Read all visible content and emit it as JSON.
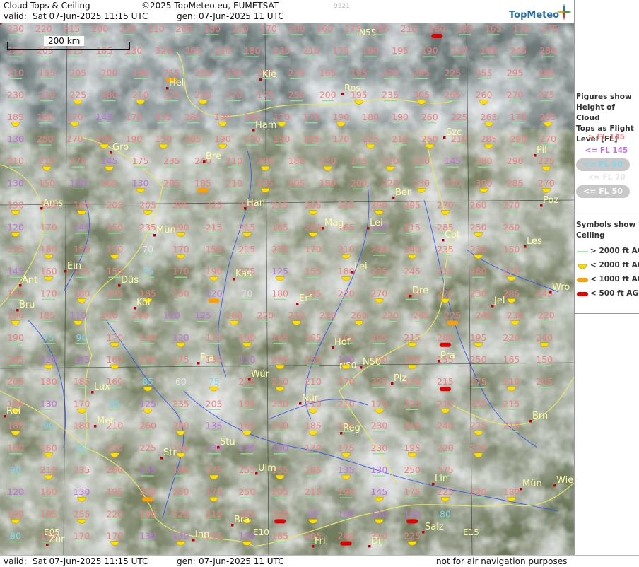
{
  "header": {
    "title": "Cloud Tops & Ceiling",
    "copyright": "©2025 TopMeteo.eu, EUMETSAT",
    "image_code": "9521",
    "valid_label": "valid:",
    "valid_value": "Sat   07-Jun-2025  11:15 UTC",
    "gen_label": "gen:",
    "gen_value": "07-Jun-2025 11 UTC",
    "logo_text": "TopMeteo"
  },
  "footer": {
    "valid_label": "valid:",
    "valid_value": "Sat   07-Jun-2025  11:15 UTC",
    "gen_label": "gen:",
    "gen_value": "07-Jun-2025 11 UTC",
    "note": "not for air navigation purposes"
  },
  "scale": {
    "label": "200 km"
  },
  "legend": {
    "tops_title": [
      "Figures show",
      "Height of Cloud",
      "Tops as Flight",
      "Level  [FL]"
    ],
    "tops": [
      {
        "label": "> FL 145",
        "color": "#f08080",
        "style": "text"
      },
      {
        "label": "<= FL 145",
        "color": "#c070e0",
        "style": "text"
      },
      {
        "label": "<= FL 90",
        "color": "#7fd8ee",
        "style": "pill"
      },
      {
        "label": "<= FL 70",
        "color": "#e6e6e6",
        "style": "text"
      },
      {
        "label": "<= FL 50",
        "color": "#ffffff",
        "style": "pill"
      }
    ],
    "ceiling_title": [
      "Symbols show",
      "Ceiling"
    ],
    "ceiling": [
      {
        "label": "> 2000 ft AGL",
        "symbol": "line",
        "color": "#90e090"
      },
      {
        "label": "< 2000 ft AGL",
        "symbol": "half-disc",
        "color": "#ffe000"
      },
      {
        "label": "< 1000 ft AGL",
        "symbol": "bar",
        "color": "#ffa000"
      },
      {
        "label": "< 500 ft AGL",
        "symbol": "bar",
        "color": "#e00000"
      }
    ]
  },
  "map": {
    "colors": {
      "high": "#f08080",
      "mid": "#c070e0",
      "low": "#7fd8ee",
      "vlow": "#e6e6e6",
      "city": "#ffffa0",
      "city_dot": "#c00000",
      "border": "#e8e860",
      "river": "#3050ff",
      "grid": "#333333"
    },
    "grid_labels": [
      {
        "text": "N55"
      },
      {
        "text": "N50"
      },
      {
        "text": "E05"
      },
      {
        "text": "E10"
      },
      {
        "text": "E15"
      }
    ],
    "cities": [
      "Kie",
      "Hel",
      "Ros",
      "Szc",
      "Ham",
      "Gro",
      "Bre",
      "Pil",
      "Ber",
      "Ams",
      "Han",
      "Mag",
      "Lei",
      "Poz",
      "Mün",
      "Cot",
      "Les",
      "Ein",
      "Ant",
      "Düs",
      "Kas",
      "Lei",
      "Wro",
      "Bru",
      "Köl",
      "Erf",
      "Dre",
      "Jel",
      "Hof",
      "Fra",
      "Pra",
      "N50",
      "Lux",
      "Wür",
      "Plz",
      "Rei",
      "Met",
      "Nür",
      "Reg",
      "Brn",
      "Str",
      "Stu",
      "Ulm",
      "Lin",
      "Mün",
      "Wie",
      "Bra",
      "Fri",
      "Inn",
      "Zür",
      "Dij",
      "Salz",
      "Nöb"
    ],
    "rows": [
      [
        "230",
        "220",
        "215",
        "200",
        "210",
        "210",
        "200",
        "180",
        "210",
        "170",
        "200",
        "165",
        "175",
        "185",
        "210",
        "180",
        "185",
        "165",
        "170",
        "175"
      ],
      [
        "220",
        "205",
        "215",
        "185",
        "230",
        "320",
        "265",
        "210",
        "180",
        "235",
        "210",
        "175",
        "180",
        "195",
        "190",
        "210",
        "195",
        "245",
        "280"
      ],
      [
        "210",
        "155",
        "205",
        "200",
        "190",
        "215",
        "220",
        "235",
        "225",
        "235",
        "165",
        "195",
        "220",
        "285",
        "225",
        "255",
        "295",
        "285"
      ],
      [
        "230",
        "210",
        "225",
        "180",
        "210",
        "225",
        "220",
        "170",
        "175",
        "250",
        "200",
        "195",
        "235",
        "305",
        "265",
        "260",
        "270",
        "275"
      ],
      [
        "185",
        "180",
        "170",
        "145",
        "170",
        "435",
        "285",
        "190",
        "180",
        "170",
        "170",
        "190",
        "180",
        "190",
        "260",
        "225",
        "265",
        "175",
        "285"
      ],
      [
        "130",
        "250",
        "270",
        "200",
        "190",
        "150",
        "205",
        "190",
        "170",
        "150",
        "185",
        "170",
        "225",
        "210",
        "260",
        "210",
        "285",
        "290",
        "270"
      ],
      [
        "210",
        "210",
        "170",
        "145",
        "175",
        "235",
        "240",
        "210",
        "200",
        "180",
        "230",
        "175",
        "220",
        "230",
        "145",
        "280",
        "290",
        "225"
      ],
      [
        "130",
        "150",
        "130",
        "160",
        "130",
        "205",
        "185",
        "210",
        "235",
        "205",
        "180",
        "200",
        "220",
        "230",
        "270",
        "300",
        "285",
        "270"
      ],
      [
        "190",
        "185",
        "160",
        "205",
        "205",
        "205",
        "225",
        "215",
        "215",
        "205",
        "215",
        "290",
        "295",
        "270",
        "260",
        "270"
      ],
      [
        "120",
        "170",
        "145",
        "150",
        "235",
        "190",
        "215",
        "215",
        "185",
        "200",
        "165",
        "130",
        "215",
        "285",
        "250",
        "260"
      ],
      [
        "175",
        "180",
        "150",
        "170",
        "70",
        "170",
        "150",
        "215",
        "235",
        "170",
        "210",
        "250",
        "240",
        "235",
        "230",
        "150"
      ],
      [
        "145",
        "160",
        "175",
        "150",
        "75",
        "170",
        "190",
        "175",
        "125",
        "155",
        "180",
        "235",
        "245",
        "215",
        "280",
        "270"
      ],
      [
        "185",
        "170",
        "180",
        "195",
        "185",
        "150",
        "120",
        "70",
        "180",
        "185",
        "220",
        "270",
        "220",
        "225",
        "230",
        "285",
        "245"
      ],
      [
        "190",
        "185",
        "110",
        "240",
        "200",
        "120",
        "125",
        "160",
        "220",
        "210",
        "220",
        "260",
        "220",
        "265",
        "225",
        "245",
        "230",
        "220"
      ],
      [
        "190",
        "75",
        "90",
        "170",
        "190",
        "120",
        "170",
        "190",
        "165",
        "165",
        "165",
        "205",
        "215",
        "280",
        "195",
        "220",
        "240"
      ],
      [
        "285",
        "120",
        "145",
        "160",
        "190",
        "175",
        "150",
        "110",
        "205",
        "150",
        "130",
        "150",
        "185",
        "155",
        "250",
        "165",
        "150"
      ],
      [
        "205",
        "180",
        "185",
        "160",
        "85",
        "60",
        "75",
        "225",
        "210",
        "210",
        "270",
        "225",
        "230",
        "215",
        "275",
        "210",
        "205"
      ],
      [
        "180",
        "130",
        "170",
        "85",
        "125",
        "235",
        "205",
        "190",
        "230",
        "210",
        "210",
        "170",
        "225",
        "210",
        "235",
        "215"
      ],
      [
        "185",
        "90",
        "180",
        "210",
        "260",
        "240",
        "135",
        "165",
        "150",
        "185",
        "195",
        "230",
        "210",
        "240",
        "275",
        "210"
      ],
      [
        "160",
        "160",
        "90",
        "210",
        "225",
        "195",
        "130",
        "130",
        "130",
        "170",
        "175",
        "230",
        "195",
        "220",
        "220"
      ],
      [
        "90",
        "215",
        "235",
        "260",
        "135",
        "190",
        "175",
        "255",
        "155",
        "185",
        "135",
        "130",
        "250",
        "175"
      ],
      [
        "120",
        "160",
        "130",
        "195",
        "200",
        "250",
        "170",
        "250",
        "205",
        "215",
        "190",
        "145",
        "175",
        "225",
        "220",
        "180"
      ],
      [
        "190",
        "165",
        "255",
        "220",
        "180",
        "220",
        "210",
        "255",
        "190",
        "95",
        "140",
        "140",
        "130",
        "80"
      ],
      [
        "80",
        "150",
        "170",
        "170",
        "130",
        "130",
        "215",
        "130",
        "185",
        "205",
        "240",
        "210",
        "225"
      ]
    ]
  }
}
